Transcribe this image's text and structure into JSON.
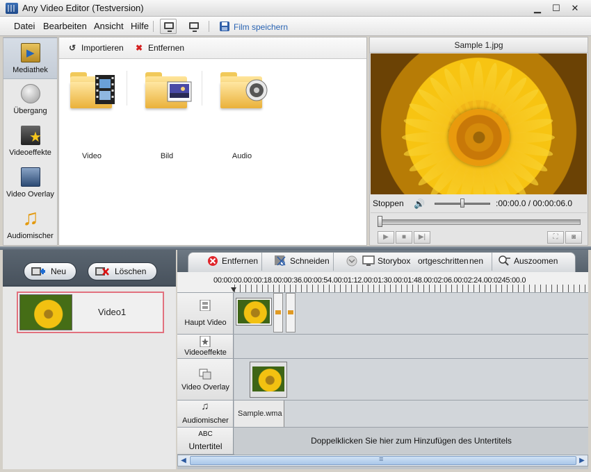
{
  "window": {
    "title": "Any Video Editor (Testversion)",
    "controls": {
      "minimize": "▁",
      "maximize": "☐",
      "close": "✕"
    }
  },
  "menu": {
    "items": [
      "Datei",
      "Bearbeiten",
      "Ansicht",
      "Hilfe"
    ],
    "save_label": "Film speichern",
    "save_color": "#2a64b3"
  },
  "nav": {
    "items": [
      {
        "label": "Mediathek",
        "icon": "media-library-icon",
        "active": true
      },
      {
        "label": "Übergang",
        "icon": "transition-icon"
      },
      {
        "label": "Videoeffekte",
        "icon": "video-effects-icon"
      },
      {
        "label": "Video Overlay",
        "icon": "video-overlay-icon"
      },
      {
        "label": "Audiomischer",
        "icon": "audio-mixer-icon"
      }
    ]
  },
  "media": {
    "import_label": "Importieren",
    "remove_label": "Entfernen",
    "folders": [
      "Video",
      "Bild",
      "Audio"
    ]
  },
  "preview": {
    "title": "Sample 1.jpg",
    "stop_label": "Stoppen",
    "time": ":00:00.0 / 00:00:06.0",
    "volume_fraction": 0.5,
    "seek_fraction": 0.0
  },
  "storyboard": {
    "new_label": "Neu",
    "delete_label": "Löschen",
    "projects": [
      "Video1"
    ]
  },
  "timeline": {
    "toolbar": {
      "remove": "Entfernen",
      "cut": "Schneiden",
      "storybox": "Storybox",
      "progress": "ortgeschritten",
      "hidden": "nen",
      "zoom_out": "Auszoomen"
    },
    "ruler": "00:00:00.00:00:18.00:00:36.00:00:54.00:01:12.00:01:30.00:01:48.00:02:06.00:02:24.00:0245:00.0",
    "tracks": {
      "main_video": "Haupt Video",
      "effects": "Videoeffekte",
      "overlay": "Video Overlay",
      "audio": "Audiomischer",
      "subtitle_abc": "ABC",
      "subtitle": "Untertitel"
    },
    "audio_clip": "Sample.wma",
    "subtitle_hint": "Doppelklicken Sie hier zum Hinzufügen des Untertitels"
  }
}
